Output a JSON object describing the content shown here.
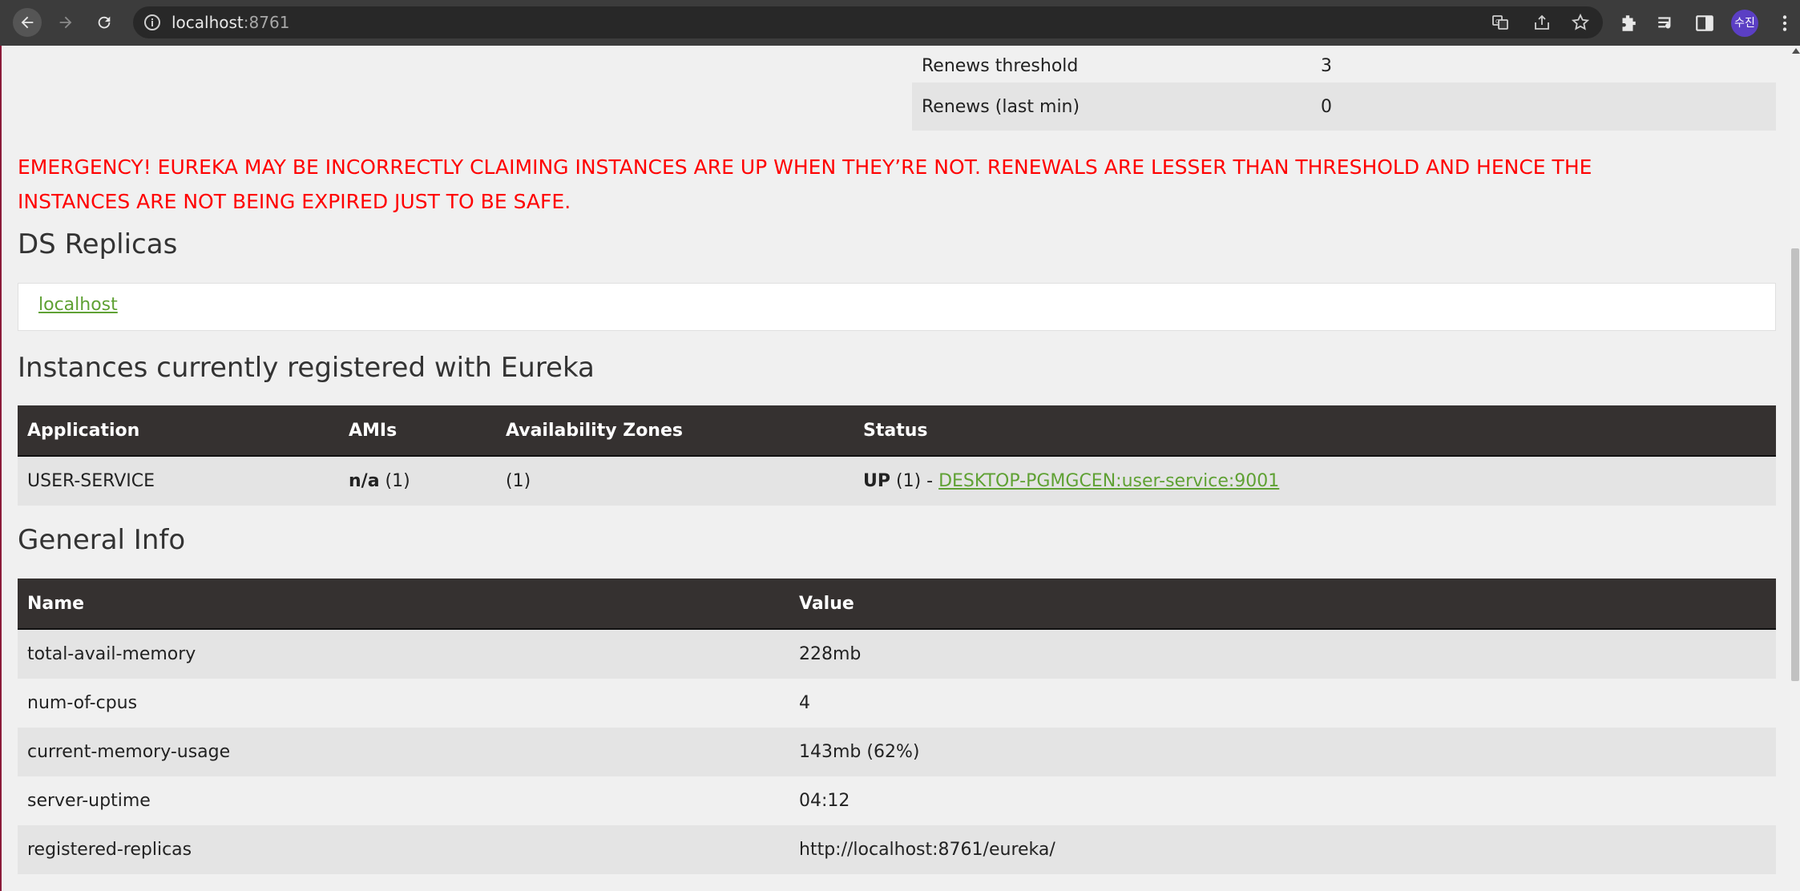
{
  "browser": {
    "url_host": "localhost",
    "url_port": ":8761",
    "profile_initials": "수진",
    "icons": [
      "back-icon",
      "forward-icon",
      "reload-icon",
      "site-info-icon",
      "translate-icon",
      "share-icon",
      "bookmark-star-icon",
      "extensions-icon",
      "reading-list-icon",
      "side-panel-icon",
      "menu-icon"
    ]
  },
  "renews": [
    {
      "label": "Renews threshold",
      "value": "3"
    },
    {
      "label": "Renews (last min)",
      "value": "0"
    }
  ],
  "emergency": {
    "line1": "EMERGENCY! EUREKA MAY BE INCORRECTLY CLAIMING INSTANCES ARE UP WHEN THEY’RE NOT. RENEWALS ARE LESSER THAN THRESHOLD AND HENCE THE",
    "line2": "INSTANCES ARE NOT BEING EXPIRED JUST TO BE SAFE.",
    "color": "#ff0000"
  },
  "replicas": {
    "title": "DS Replicas",
    "link": "localhost"
  },
  "instances": {
    "title": "Instances currently registered with Eureka",
    "headers": [
      "Application",
      "AMIs",
      "Availability Zones",
      "Status"
    ],
    "rows": [
      {
        "application": "USER-SERVICE",
        "amis_bold": "n/a",
        "amis_count": " (1)",
        "zones": "(1)",
        "status_bold": "UP",
        "status_count": " (1) - ",
        "status_link": "DESKTOP-PGMGCEN:user-service:9001"
      }
    ]
  },
  "general": {
    "title": "General Info",
    "headers": [
      "Name",
      "Value"
    ],
    "rows": [
      {
        "name": "total-avail-memory",
        "value": "228mb"
      },
      {
        "name": "num-of-cpus",
        "value": "4"
      },
      {
        "name": "current-memory-usage",
        "value": "143mb (62%)"
      },
      {
        "name": "server-uptime",
        "value": "04:12"
      },
      {
        "name": "registered-replicas",
        "value": "http://localhost:8761/eureka/"
      }
    ]
  },
  "colors": {
    "link": "#5fa134",
    "header_bg": "#353130",
    "accent_border": "#8b1a3a"
  }
}
